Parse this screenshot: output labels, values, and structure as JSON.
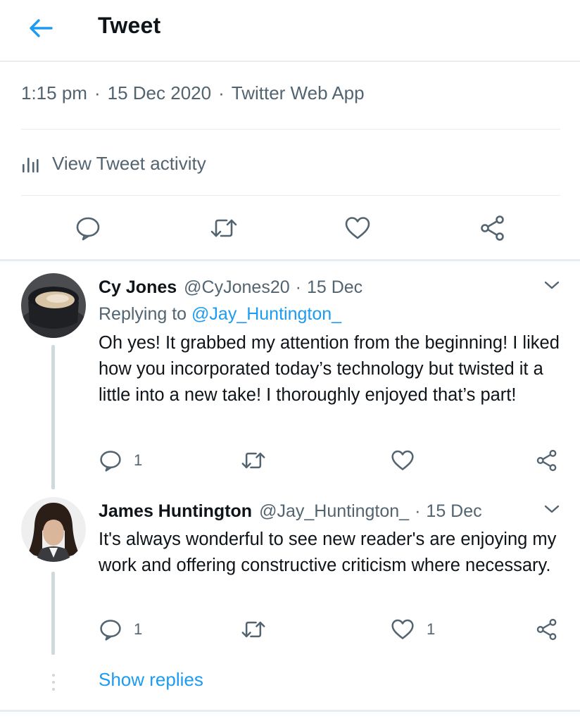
{
  "header": {
    "title": "Tweet",
    "back_icon": "arrow-left-icon",
    "accent": "#1d9bf0"
  },
  "tweet_meta": {
    "time": "1:15 pm",
    "date": "15 Dec 2020",
    "source": "Twitter Web App",
    "separator": "·"
  },
  "activity": {
    "label": "View Tweet activity",
    "icon": "bar-chart-icon"
  },
  "main_actions": [
    "reply-icon",
    "retweet-icon",
    "like-icon",
    "share-icon"
  ],
  "replies": [
    {
      "name": "Cy Jones",
      "handle": "@CyJones20",
      "date": "15 Dec",
      "replying_prefix": "Replying to",
      "replying_to": "@Jay_Huntington_",
      "text": "Oh yes! It grabbed my attention from the beginning! I liked how you incorporated today’s technology but twisted it a little into a new take! I thoroughly enjoyed that’s part!",
      "counts": {
        "reply": "1",
        "retweet": "",
        "like": ""
      }
    },
    {
      "name": "James Huntington",
      "handle": "@Jay_Huntington_",
      "date": "15 Dec",
      "text": "It's always wonderful to see new reader's are enjoying my work and offering constructive criticism where necessary.",
      "counts": {
        "reply": "1",
        "retweet": "",
        "like": "1"
      }
    }
  ],
  "show_replies": "Show replies",
  "separator": "·"
}
